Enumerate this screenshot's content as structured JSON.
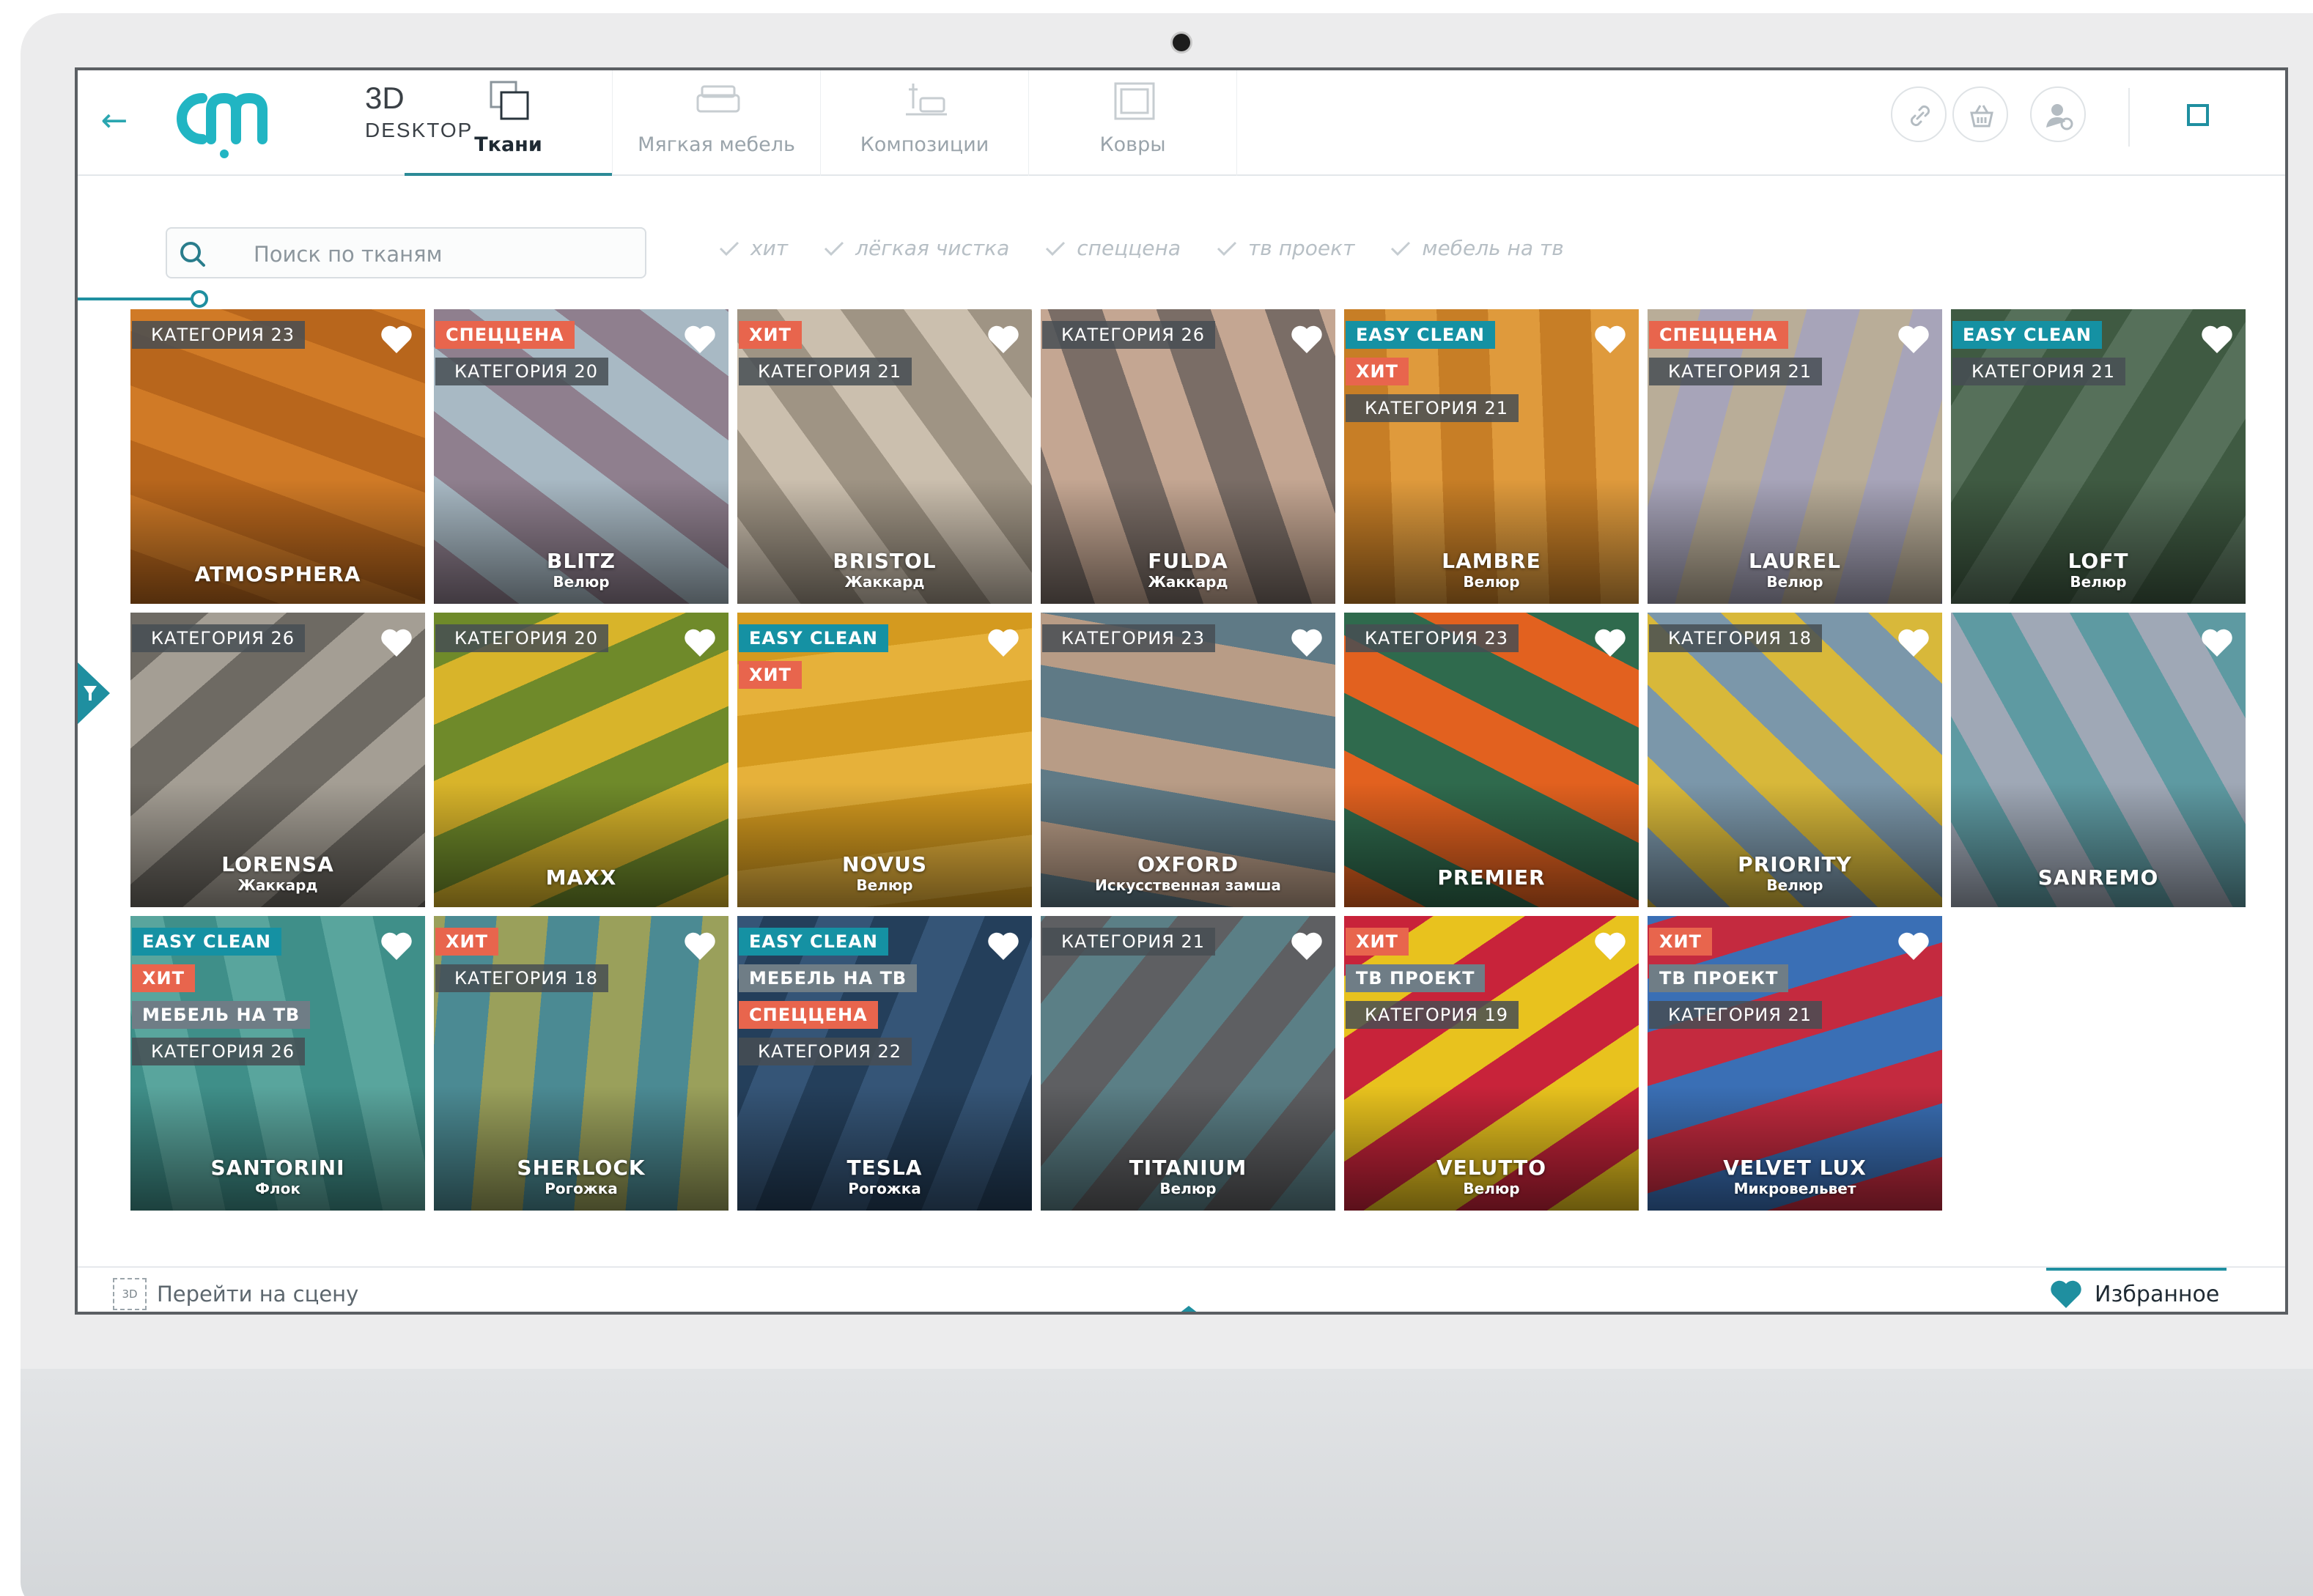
{
  "app": {
    "logo_3d": "3D",
    "logo_desktop": "DESKTOP"
  },
  "tabs": [
    {
      "label": "Ткани",
      "active": true,
      "icon": "fabric-icon"
    },
    {
      "label": "Мягкая мебель",
      "active": false,
      "icon": "sofa-icon"
    },
    {
      "label": "Композиции",
      "active": false,
      "icon": "composition-icon"
    },
    {
      "label": "Ковры",
      "active": false,
      "icon": "carpet-icon"
    }
  ],
  "header_actions": [
    "link-icon",
    "basket-icon",
    "user-settings-icon",
    "maximize-icon"
  ],
  "search": {
    "placeholder": "Поиск по тканям"
  },
  "filters": [
    {
      "label": "хит",
      "checked": false
    },
    {
      "label": "лёгкая чистка",
      "checked": false
    },
    {
      "label": "спеццена",
      "checked": false
    },
    {
      "label": "тв проект",
      "checked": false
    },
    {
      "label": "мебель на тв",
      "checked": false
    }
  ],
  "fabrics": [
    {
      "name": "ATMOSPHERA",
      "subtitle": "",
      "badges": [
        {
          "type": "cat",
          "text": "КАТЕГОРИЯ 23"
        }
      ],
      "colors": [
        "#b8661c",
        "#d07a26"
      ]
    },
    {
      "name": "BLITZ",
      "subtitle": "Велюр",
      "badges": [
        {
          "type": "special",
          "text": "СПЕЦЦЕНА"
        },
        {
          "type": "cat",
          "text": "КАТЕГОРИЯ 20"
        }
      ],
      "colors": [
        "#8f7f8e",
        "#a8b9c4"
      ]
    },
    {
      "name": "BRISTOL",
      "subtitle": "Жаккард",
      "badges": [
        {
          "type": "hit",
          "text": "ХИТ"
        },
        {
          "type": "cat",
          "text": "КАТЕГОРИЯ 21"
        }
      ],
      "colors": [
        "#cbbfae",
        "#9f9484"
      ]
    },
    {
      "name": "FULDA",
      "subtitle": "Жаккард",
      "badges": [
        {
          "type": "cat",
          "text": "КАТЕГОРИЯ 26"
        }
      ],
      "colors": [
        "#7a6d66",
        "#c4a692"
      ]
    },
    {
      "name": "LAMBRE",
      "subtitle": "Велюр",
      "badges": [
        {
          "type": "easy",
          "text": "EASY CLEAN"
        },
        {
          "type": "hit",
          "text": "ХИТ"
        },
        {
          "type": "cat",
          "text": "КАТЕГОРИЯ 21"
        }
      ],
      "colors": [
        "#c77e26",
        "#df9a3c"
      ]
    },
    {
      "name": "LAUREL",
      "subtitle": "Велюр",
      "badges": [
        {
          "type": "special",
          "text": "СПЕЦЦЕНА"
        },
        {
          "type": "cat",
          "text": "КАТЕГОРИЯ 21"
        }
      ],
      "colors": [
        "#b9ad98",
        "#a7a4b9"
      ]
    },
    {
      "name": "LOFT",
      "subtitle": "Велюр",
      "badges": [
        {
          "type": "easy",
          "text": "EASY CLEAN"
        },
        {
          "type": "cat",
          "text": "КАТЕГОРИЯ 21"
        }
      ],
      "colors": [
        "#3f5a42",
        "#56705a"
      ]
    },
    {
      "name": "LORENSA",
      "subtitle": "Жаккард",
      "badges": [
        {
          "type": "cat",
          "text": "КАТЕГОРИЯ 26"
        }
      ],
      "colors": [
        "#6e6a63",
        "#a49e94"
      ]
    },
    {
      "name": "MAXX",
      "subtitle": "",
      "badges": [
        {
          "type": "cat",
          "text": "КАТЕГОРИЯ 20"
        }
      ],
      "colors": [
        "#6f8a2a",
        "#d8b42a"
      ]
    },
    {
      "name": "NOVUS",
      "subtitle": "Велюр",
      "badges": [
        {
          "type": "easy",
          "text": "EASY CLEAN"
        },
        {
          "type": "hit",
          "text": "ХИТ"
        }
      ],
      "colors": [
        "#d49a1f",
        "#e6b13a"
      ]
    },
    {
      "name": "OXFORD",
      "subtitle": "Искусственная замша",
      "badges": [
        {
          "type": "cat",
          "text": "КАТЕГОРИЯ 23"
        }
      ],
      "colors": [
        "#5f7a86",
        "#b89c86"
      ]
    },
    {
      "name": "PREMIER",
      "subtitle": "",
      "badges": [
        {
          "type": "cat",
          "text": "КАТЕГОРИЯ 23"
        }
      ],
      "colors": [
        "#2f6a4d",
        "#e2611f"
      ]
    },
    {
      "name": "PRIORITY",
      "subtitle": "Велюр",
      "badges": [
        {
          "type": "cat",
          "text": "КАТЕГОРИЯ 18"
        }
      ],
      "colors": [
        "#d8b83a",
        "#7b97aa"
      ]
    },
    {
      "name": "SANREMO",
      "subtitle": "",
      "badges": [],
      "colors": [
        "#5e9aa2",
        "#9fa8b6"
      ]
    },
    {
      "name": "SANTORINI",
      "subtitle": "Флок",
      "badges": [
        {
          "type": "easy",
          "text": "EASY CLEAN"
        },
        {
          "type": "hit",
          "text": "ХИТ"
        },
        {
          "type": "tv",
          "text": "МЕБЕЛЬ НА ТВ"
        },
        {
          "type": "cat",
          "text": "КАТЕГОРИЯ 26"
        }
      ],
      "colors": [
        "#3f8f89",
        "#59a59d"
      ]
    },
    {
      "name": "SHERLOCK",
      "subtitle": "Рогожка",
      "badges": [
        {
          "type": "hit",
          "text": "ХИТ"
        },
        {
          "type": "cat",
          "text": "КАТЕГОРИЯ 18"
        }
      ],
      "colors": [
        "#9aa05b",
        "#4b8a93"
      ]
    },
    {
      "name": "TESLA",
      "subtitle": "Рогожка",
      "badges": [
        {
          "type": "easy",
          "text": "EASY CLEAN"
        },
        {
          "type": "tv",
          "text": "МЕБЕЛЬ НА ТВ"
        },
        {
          "type": "special",
          "text": "СПЕЦЦЕНА"
        },
        {
          "type": "cat",
          "text": "КАТЕГОРИЯ 22"
        }
      ],
      "colors": [
        "#243f5b",
        "#355577"
      ]
    },
    {
      "name": "TITANIUM",
      "subtitle": "Велюр",
      "badges": [
        {
          "type": "cat",
          "text": "КАТЕГОРИЯ 21"
        }
      ],
      "colors": [
        "#5b7f86",
        "#5e5f62"
      ]
    },
    {
      "name": "VELUTTO",
      "subtitle": "Велюр",
      "badges": [
        {
          "type": "hit",
          "text": "ХИТ"
        },
        {
          "type": "tv",
          "text": "ТВ ПРОЕКТ"
        },
        {
          "type": "cat",
          "text": "КАТЕГОРИЯ 19"
        }
      ],
      "colors": [
        "#e8c21e",
        "#c8233a"
      ]
    },
    {
      "name": "VELVET LUX",
      "subtitle": "Микровельвет",
      "badges": [
        {
          "type": "hit",
          "text": "ХИТ"
        },
        {
          "type": "tv",
          "text": "ТВ ПРОЕКТ"
        },
        {
          "type": "cat",
          "text": "КАТЕГОРИЯ 21"
        }
      ],
      "colors": [
        "#c42a3f",
        "#3a6fb5"
      ]
    }
  ],
  "footer": {
    "goto_scene_label": "Перейти на сцену",
    "goto_scene_icon_text": "3D",
    "favorites_label": "Избранное"
  },
  "colors": {
    "accent": "#1f8fa0",
    "hit": "#e8654d",
    "easy_clean": "#1591a3"
  }
}
